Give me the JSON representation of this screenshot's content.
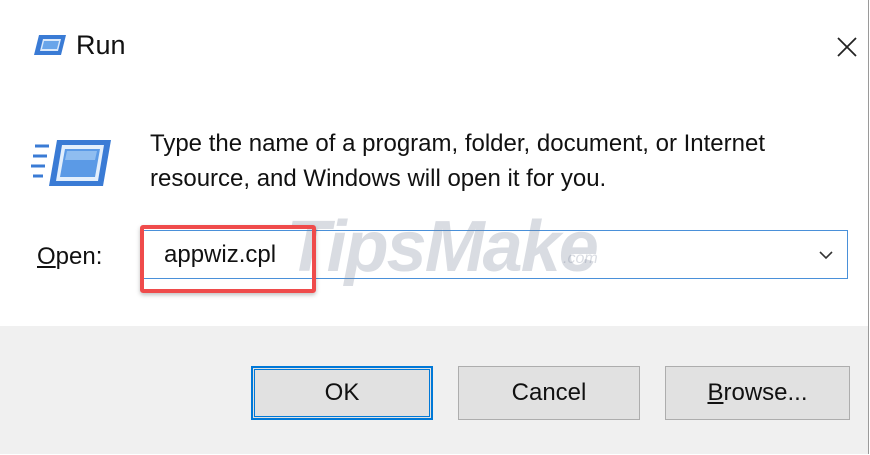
{
  "window": {
    "title": "Run",
    "title_icon": "run-icon",
    "close_icon": "close-icon"
  },
  "body": {
    "icon": "run-large-icon",
    "description_line1": "Type the name of a program, folder, document, or Internet",
    "description_line2": "resource, and Windows will open it for you.",
    "open_label_underlined": "O",
    "open_label_rest": "pen:",
    "open_value": "appwiz.cpl",
    "dropdown_icon": "chevron-down-icon"
  },
  "watermark": {
    "text": "TipsMake",
    "suffix": ".com"
  },
  "buttons": {
    "ok_label": "OK",
    "cancel_label": "Cancel",
    "browse_underlined": "B",
    "browse_rest": "rowse..."
  },
  "colors": {
    "accent": "#0078d7",
    "highlight": "#ef4b4b",
    "footer_bg": "#f0f0f0"
  }
}
